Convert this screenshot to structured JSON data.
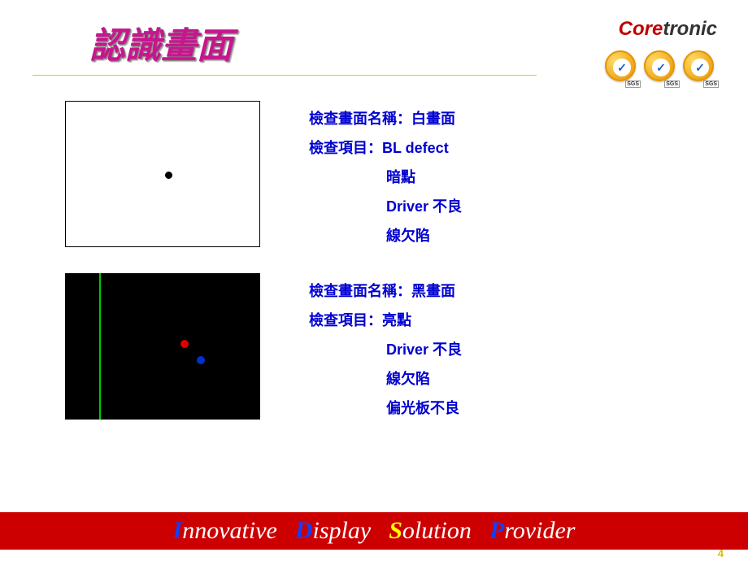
{
  "header": {
    "title": "認識畫面",
    "logo": {
      "part1": "Core",
      "part2": "tronic"
    },
    "badge_label": "SGS"
  },
  "sections": [
    {
      "name_label": "檢查畫面名稱：白畫面",
      "item_label": "檢查項目：BL defect",
      "items": [
        "暗點",
        "Driver 不良",
        "線欠陷"
      ]
    },
    {
      "name_label": "檢查畫面名稱：黑畫面",
      "item_label": "檢查項目：亮點",
      "items": [
        "Driver 不良",
        "線欠陷",
        "偏光板不良"
      ]
    }
  ],
  "footer": {
    "words": [
      {
        "cap": "I",
        "cap_class": "cap-blue",
        "rest": "nnovative"
      },
      {
        "cap": "D",
        "cap_class": "cap-blue",
        "rest": "isplay"
      },
      {
        "cap": "S",
        "cap_class": "cap-yellow",
        "rest": "olution"
      },
      {
        "cap": "P",
        "cap_class": "cap-blue",
        "rest": "rovider"
      }
    ]
  },
  "page_number": "4"
}
